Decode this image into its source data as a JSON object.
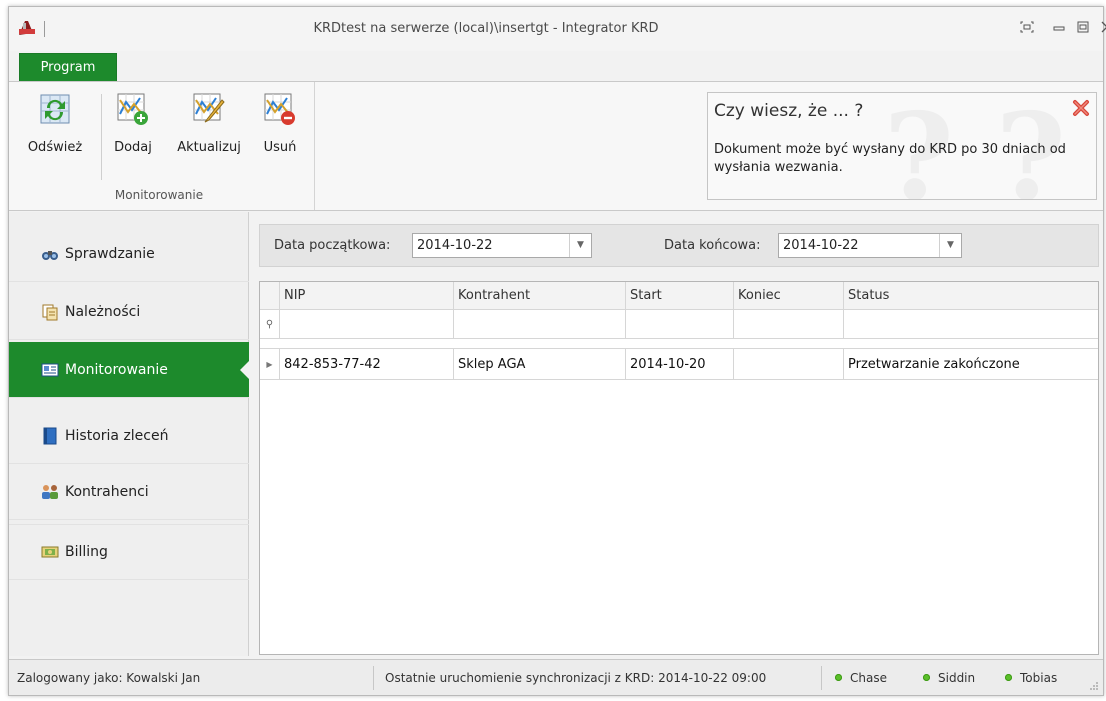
{
  "window": {
    "title": "KRDtest na serwerze (local)\\insertgt - Integrator KRD"
  },
  "ribbon": {
    "tab_label": "Program",
    "buttons": [
      {
        "label": "Odśwież",
        "icon": "refresh-icon"
      },
      {
        "label": "Dodaj",
        "icon": "chart-add-icon"
      },
      {
        "label": "Aktualizuj",
        "icon": "chart-edit-icon"
      },
      {
        "label": "Usuń",
        "icon": "chart-remove-icon"
      }
    ],
    "group_label": "Monitorowanie"
  },
  "tip": {
    "title": "Czy wiesz, że ... ?",
    "body": "Dokument może być wysłany do KRD po 30 dniach od wysłania wezwania."
  },
  "sidebar": {
    "items": [
      {
        "label": "Sprawdzanie",
        "icon": "binoculars-icon"
      },
      {
        "label": "Należności",
        "icon": "documents-icon"
      },
      {
        "label": "Monitorowanie",
        "icon": "monitor-card-icon",
        "active": true
      },
      {
        "label": "Historia zleceń",
        "icon": "book-icon"
      },
      {
        "label": "Kontrahenci",
        "icon": "people-icon"
      },
      {
        "label": "Billing",
        "icon": "money-icon"
      }
    ]
  },
  "filters": {
    "start_label": "Data początkowa:",
    "start_value": "2014-10-22",
    "end_label": "Data końcowa:",
    "end_value": "2014-10-22"
  },
  "grid": {
    "columns": [
      "NIP",
      "Kontrahent",
      "Start",
      "Koniec",
      "Status"
    ],
    "rows": [
      {
        "nip": "842-853-77-42",
        "kontrahent": "Sklep AGA",
        "start": "2014-10-20",
        "koniec": "",
        "status": "Przetwarzanie zakończone"
      }
    ]
  },
  "statusbar": {
    "user": "Zalogowany jako: Kowalski Jan",
    "sync": "Ostatnie uruchomienie synchronizacji z KRD: 2014-10-22 09:00",
    "indicators": [
      "Chase",
      "Siddin",
      "Tobias"
    ]
  },
  "colors": {
    "accent": "#1d8a2c",
    "status_ok": "#2b8a1b",
    "indicator": "#5bbf2a"
  }
}
